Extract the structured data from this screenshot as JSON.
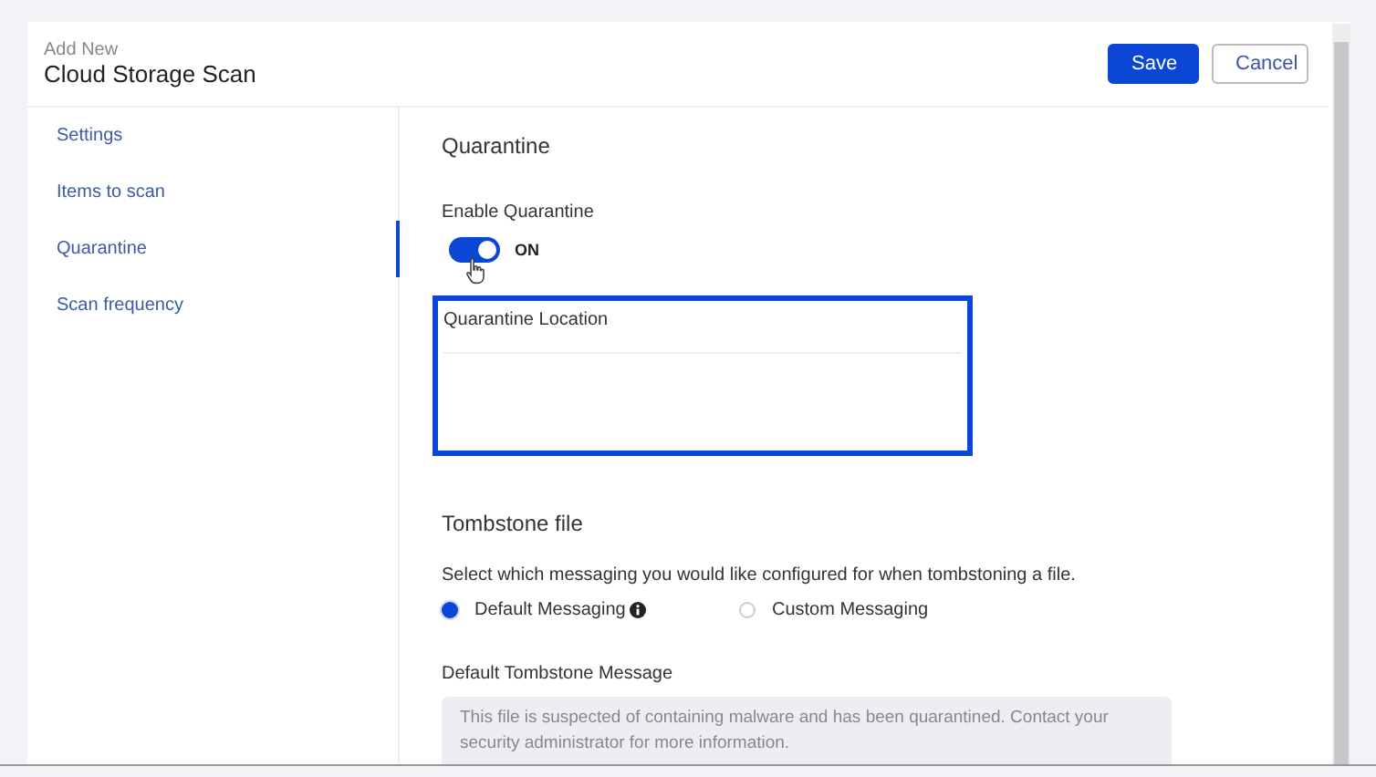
{
  "header": {
    "subtitle": "Add New",
    "title": "Cloud Storage Scan",
    "buttons": [
      {
        "label": "Save",
        "kind": "primary"
      },
      {
        "label": "Cancel",
        "kind": "secondary"
      }
    ]
  },
  "sidebar": {
    "items": [
      {
        "label": "Settings",
        "selected": false
      },
      {
        "label": "Items to scan",
        "selected": false
      },
      {
        "label": "Quarantine",
        "selected": true
      },
      {
        "label": "Scan frequency",
        "selected": false
      }
    ]
  },
  "quarantine": {
    "heading": "Quarantine",
    "toggle_label": "Enable Quarantine",
    "toggle": {
      "on": true,
      "text": "ON"
    },
    "location": {
      "label": "Quarantine Location",
      "highlighted": true
    }
  },
  "tombstone": {
    "heading": "Tombstone file",
    "description": "Select which messaging you would like configured for when tombstoning a file.",
    "options": [
      {
        "label": "Default Messaging",
        "selected": true,
        "info": true
      },
      {
        "label": "Custom Messaging",
        "selected": false,
        "info": false
      }
    ],
    "message_label": "Default Tombstone Message",
    "message": "This file is suspected of containing malware and has been quarantined. Contact your security administrator for more information."
  }
}
